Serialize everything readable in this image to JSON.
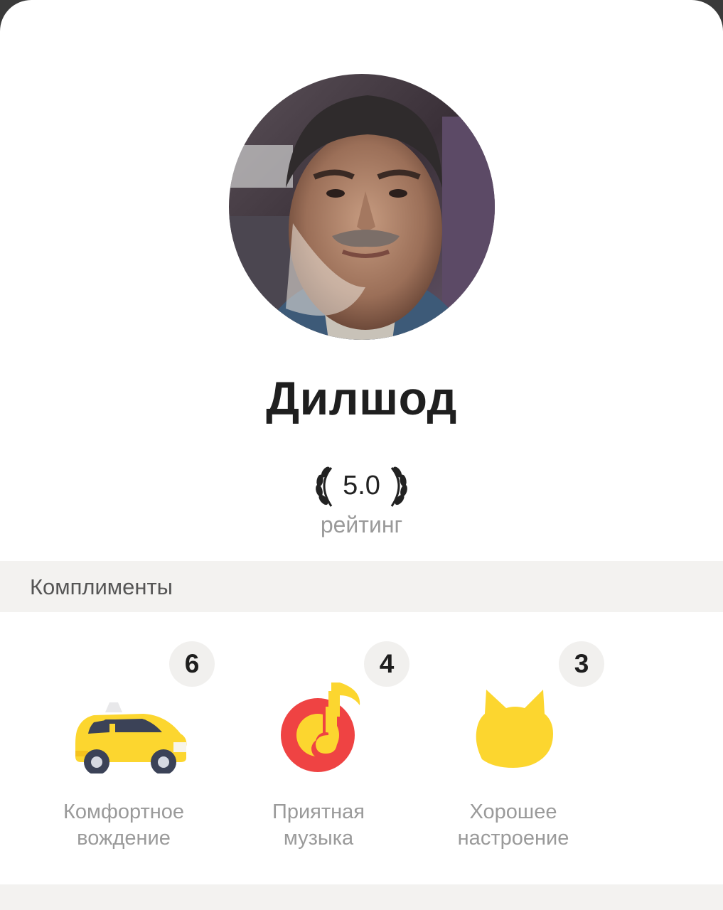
{
  "driver": {
    "name": "Дилшод",
    "rating": "5.0",
    "rating_caption": "рейтинг"
  },
  "compliments": {
    "title": "Комплименты",
    "items": [
      {
        "count": "6",
        "line1": "Комфортное",
        "line2": "вождение",
        "icon": "taxi-car-icon"
      },
      {
        "count": "4",
        "line1": "Приятная",
        "line2": "музыка",
        "icon": "music-note-icon"
      },
      {
        "count": "3",
        "line1": "Хорошее",
        "line2": "настроение",
        "icon": "cat-face-icon"
      }
    ]
  },
  "colors": {
    "accent_yellow": "#fcd62f",
    "music_red": "#ef4343",
    "section_bg": "#f3f2f0",
    "muted_text": "#9a9a9a"
  }
}
